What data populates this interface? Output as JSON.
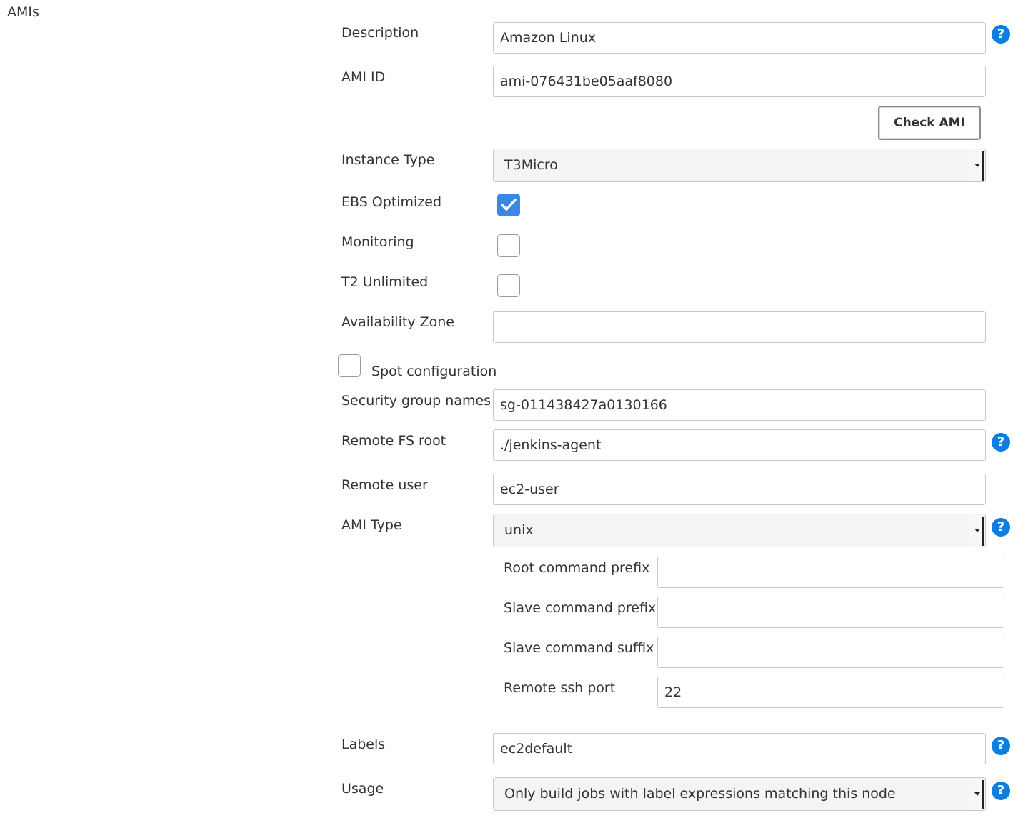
{
  "section": {
    "title": "AMIs"
  },
  "fields": {
    "description": {
      "label": "Description",
      "value": "Amazon Linux"
    },
    "ami_id": {
      "label": "AMI ID",
      "value": "ami-076431be05aaf8080"
    },
    "check_ami": {
      "label": "Check AMI"
    },
    "instance_type": {
      "label": "Instance Type",
      "selected": "T3Micro"
    },
    "ebs_optimized": {
      "label": "EBS Optimized",
      "checked": true
    },
    "monitoring": {
      "label": "Monitoring",
      "checked": false
    },
    "t2_unlimited": {
      "label": "T2 Unlimited",
      "checked": false
    },
    "availability_zone": {
      "label": "Availability Zone",
      "value": ""
    },
    "spot_configuration": {
      "label": "Spot configuration",
      "checked": false
    },
    "security_group_names": {
      "label": "Security group names",
      "value": "sg-011438427a0130166"
    },
    "remote_fs_root": {
      "label": "Remote FS root",
      "value": "./jenkins-agent"
    },
    "remote_user": {
      "label": "Remote user",
      "value": "ec2-user"
    },
    "ami_type": {
      "label": "AMI Type",
      "selected": "unix",
      "root_command_prefix": {
        "label": "Root command prefix",
        "value": ""
      },
      "slave_command_prefix": {
        "label": "Slave command prefix",
        "value": ""
      },
      "slave_command_suffix": {
        "label": "Slave command suffix",
        "value": ""
      },
      "remote_ssh_port": {
        "label": "Remote ssh port",
        "value": "22"
      }
    },
    "labels": {
      "label": "Labels",
      "value": "ec2default"
    },
    "usage": {
      "label": "Usage",
      "selected": "Only build jobs with label expressions matching this node"
    }
  },
  "help_icon": {
    "glyph": "?",
    "color": "#0b7fe1"
  },
  "colors": {
    "checkbox_checked": "#3b87e4",
    "text": "#333333",
    "border": "#c9c9c9"
  }
}
